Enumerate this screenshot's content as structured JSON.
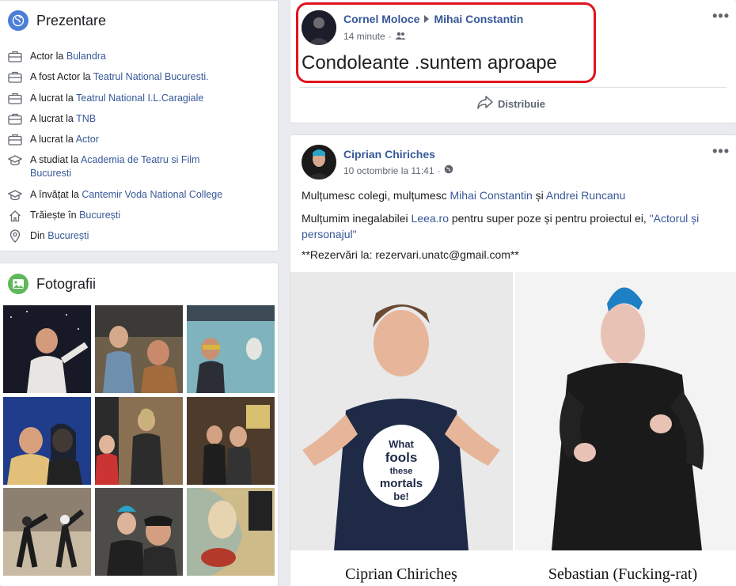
{
  "intro": {
    "title": "Prezentare",
    "items": [
      {
        "icon": "briefcase-icon",
        "prefix": "Actor la ",
        "link": "Bulandra"
      },
      {
        "icon": "briefcase-icon",
        "prefix": "A fost Actor la ",
        "link": "Teatrul National Bucuresti."
      },
      {
        "icon": "briefcase-icon",
        "prefix": "A lucrat la ",
        "link": "Teatrul National I.L.Caragiale"
      },
      {
        "icon": "briefcase-icon",
        "prefix": "A lucrat la ",
        "link": "TNB"
      },
      {
        "icon": "briefcase-icon",
        "prefix": "A lucrat la ",
        "link": "Actor"
      },
      {
        "icon": "graduation-cap-icon",
        "prefix": "A studiat la ",
        "link": "Academia de Teatru si Film Bucuresti"
      },
      {
        "icon": "graduation-cap-icon",
        "prefix": "A învățat la ",
        "link": "Cantemir Voda National College"
      },
      {
        "icon": "home-icon",
        "prefix": "Trăiește în ",
        "link": "București"
      },
      {
        "icon": "location-pin-icon",
        "prefix": "Din ",
        "link": "București"
      }
    ]
  },
  "photos": {
    "title": "Fotografii",
    "colors": [
      "#2a2a33",
      "#8a7257",
      "#3d6a7a",
      "#2f4a88",
      "#6b5a44",
      "#5e4c3a",
      "#5a5248",
      "#5d4a44",
      "#7a6a4c"
    ]
  },
  "post1": {
    "author": "Cornel Moloce",
    "target": "Mihai Constantin",
    "time": "14 minute",
    "text": "Condoleante .suntem aproape",
    "share_label": "Distribuie",
    "highlight_color": "#e0141e"
  },
  "post2": {
    "author": "Ciprian Chiriches",
    "time": "10 octombrie la 11:41",
    "line1_pre": "Mulțumesc colegi, mulțumesc ",
    "line1_link1": "Mihai Constantin",
    "line1_mid": " și ",
    "line1_link2": "Andrei Runcanu",
    "line2_pre": "Mulțumim inegalabilei ",
    "line2_link1": "Leea.ro",
    "line2_mid": " pentru super poze și pentru proiectul ei, ",
    "line2_link2": "\"Actorul și personajul\"",
    "line3": "**Rezervări la: rezervari.unatc@gmail.com**",
    "image": {
      "left_caption": "Ciprian Chiricheș",
      "right_caption": "Sebastian (Fucking-rat)",
      "shirt_text": [
        "What",
        "fools",
        "these",
        "mortals",
        "be!"
      ]
    }
  }
}
